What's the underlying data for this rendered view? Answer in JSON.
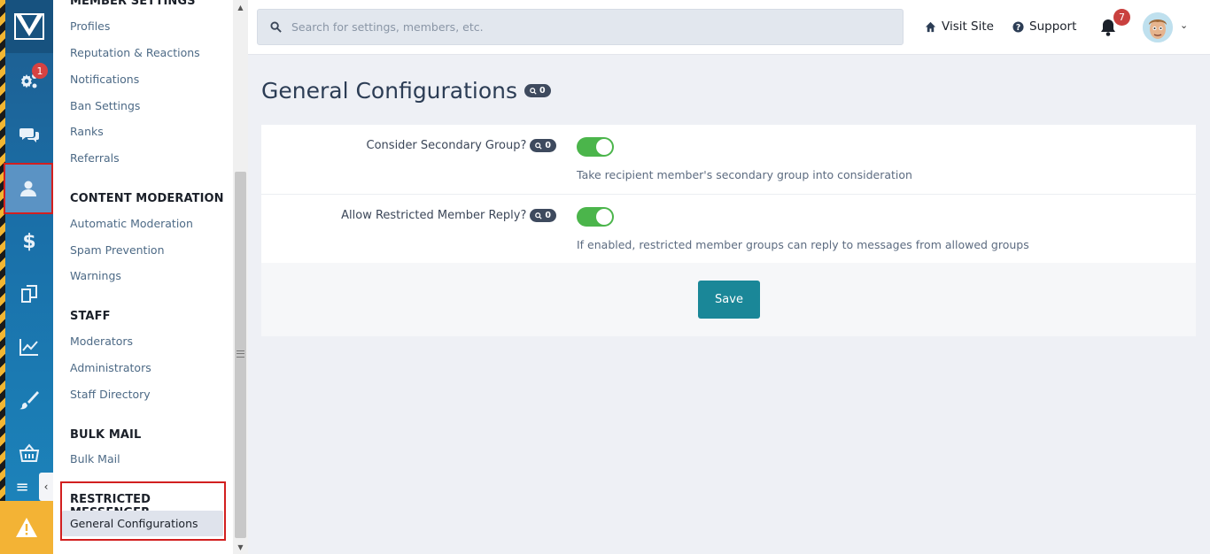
{
  "header": {
    "search_placeholder": "Search for settings, members, etc.",
    "visit_site": "Visit Site",
    "support": "Support",
    "notification_count": "7"
  },
  "rail": {
    "settings_badge": "1",
    "icons": [
      "logo-icon",
      "settings-icon",
      "chat-icon",
      "members-icon",
      "dollar-icon",
      "pages-icon",
      "stats-icon",
      "brush-icon",
      "store-icon",
      "menu-icon",
      "warning-icon"
    ]
  },
  "sidebar": {
    "sections": [
      {
        "title": "MEMBER SETTINGS",
        "items": [
          "Profiles",
          "Reputation & Reactions",
          "Notifications",
          "Ban Settings",
          "Ranks",
          "Referrals"
        ]
      },
      {
        "title": "CONTENT MODERATION",
        "items": [
          "Automatic Moderation",
          "Spam Prevention",
          "Warnings"
        ]
      },
      {
        "title": "STAFF",
        "items": [
          "Moderators",
          "Administrators",
          "Staff Directory"
        ]
      },
      {
        "title": "BULK MAIL",
        "items": [
          "Bulk Mail"
        ]
      },
      {
        "title": "RESTRICTED MESSENGER",
        "items": [
          "General Configurations"
        ]
      }
    ]
  },
  "main": {
    "title": "General Configurations",
    "title_search_count": "0",
    "settings": [
      {
        "label": "Consider Secondary Group?",
        "search_count": "0",
        "enabled": true,
        "description": "Take recipient member's secondary group into consideration"
      },
      {
        "label": "Allow Restricted Member Reply?",
        "search_count": "0",
        "enabled": true,
        "description": "If enabled, restricted member groups can reply to messages from allowed groups"
      }
    ],
    "save_label": "Save"
  },
  "colors": {
    "rail_blue": "#1a6fa8",
    "toggle_on": "#4bb54b",
    "save_button": "#1a8798",
    "badge_red": "#c9403e",
    "highlight_red": "#d21f1f"
  }
}
